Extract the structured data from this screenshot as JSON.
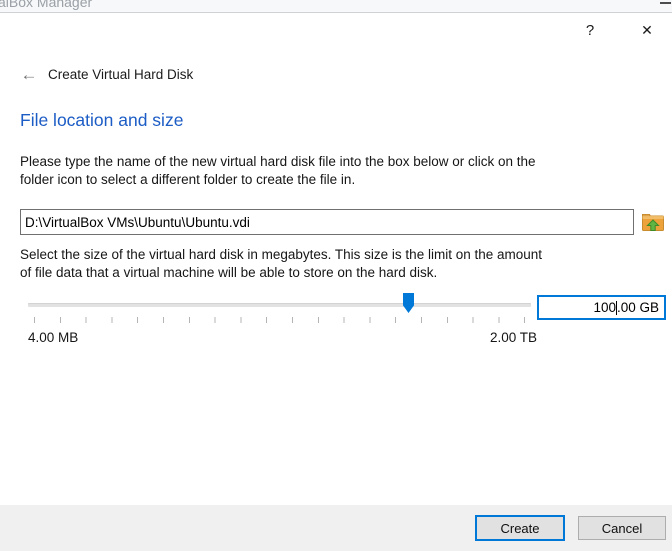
{
  "background_window": {
    "title_fragment": "alBox Manager"
  },
  "dialog": {
    "icons": {
      "help": "?",
      "close": "✕",
      "back": "←"
    },
    "title": "Create Virtual Hard Disk",
    "heading": "File location and size",
    "file_section": {
      "description": "Please type the name of the new virtual hard disk file into the box below or click on the\nfolder icon to select a different folder to create the file in.",
      "file_path_value": "D:\\VirtualBox VMs\\Ubuntu\\Ubuntu.vdi"
    },
    "size_section": {
      "description": "Select the size of the virtual hard disk in megabytes. This size is the limit on the amount\nof file data that a virtual machine will be able to store on the hard disk.",
      "size_value_before_caret": "100",
      "size_value_after_caret": ".00 GB",
      "min_label": "4.00 MB",
      "max_label": "2.00 TB"
    },
    "footer": {
      "create_label": "Create",
      "cancel_label": "Cancel"
    },
    "colors": {
      "accent_blue": "#0078d7",
      "heading_blue": "#1c5cc5",
      "folder_orange": "#eda23c",
      "arrow_green": "#61b544"
    }
  }
}
